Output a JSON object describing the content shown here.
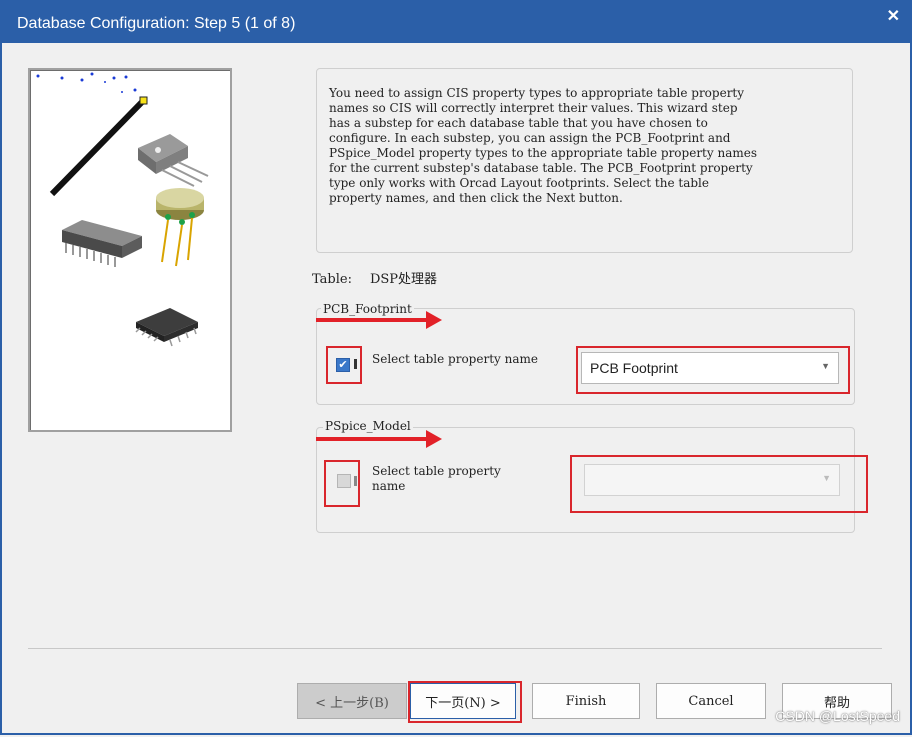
{
  "window": {
    "title": "Database Configuration: Step 5 (1 of 8)",
    "close_glyph": "✕"
  },
  "description": "You need to assign CIS property types to appropriate table property\nnames so CIS will correctly interpret their values. This wizard step\nhas a substep for each database table that you have chosen to\nconfigure. In each substep, you can assign the PCB_Footprint and\nPSpice_Model property types to the appropriate table property names\nfor the current substep's database table. The PCB_Footprint property\ntype only works with Orcad Layout footprints. Select the table\nproperty names, and then click the Next button.",
  "table": {
    "label": "Table:",
    "value": "DSP处理器"
  },
  "pcb_group": {
    "title": "PCB_Footprint",
    "checkbox_checked": true,
    "checkbox_glyph": "✔",
    "prop_label": "Select table property name",
    "selected": "PCB Footprint"
  },
  "pspice_group": {
    "title": "PSpice_Model",
    "checkbox_checked": false,
    "prop_label": "Select table property\nname",
    "selected": ""
  },
  "buttons": {
    "back": "< 上一步(B)",
    "next": "下一页(N) >",
    "finish": "Finish",
    "cancel": "Cancel",
    "help": "帮助"
  },
  "watermark": "CSDN @LostSpeed",
  "colors": {
    "titlebar": "#2b5fa8",
    "highlight": "#d9262c",
    "arrow": "#e22128"
  }
}
